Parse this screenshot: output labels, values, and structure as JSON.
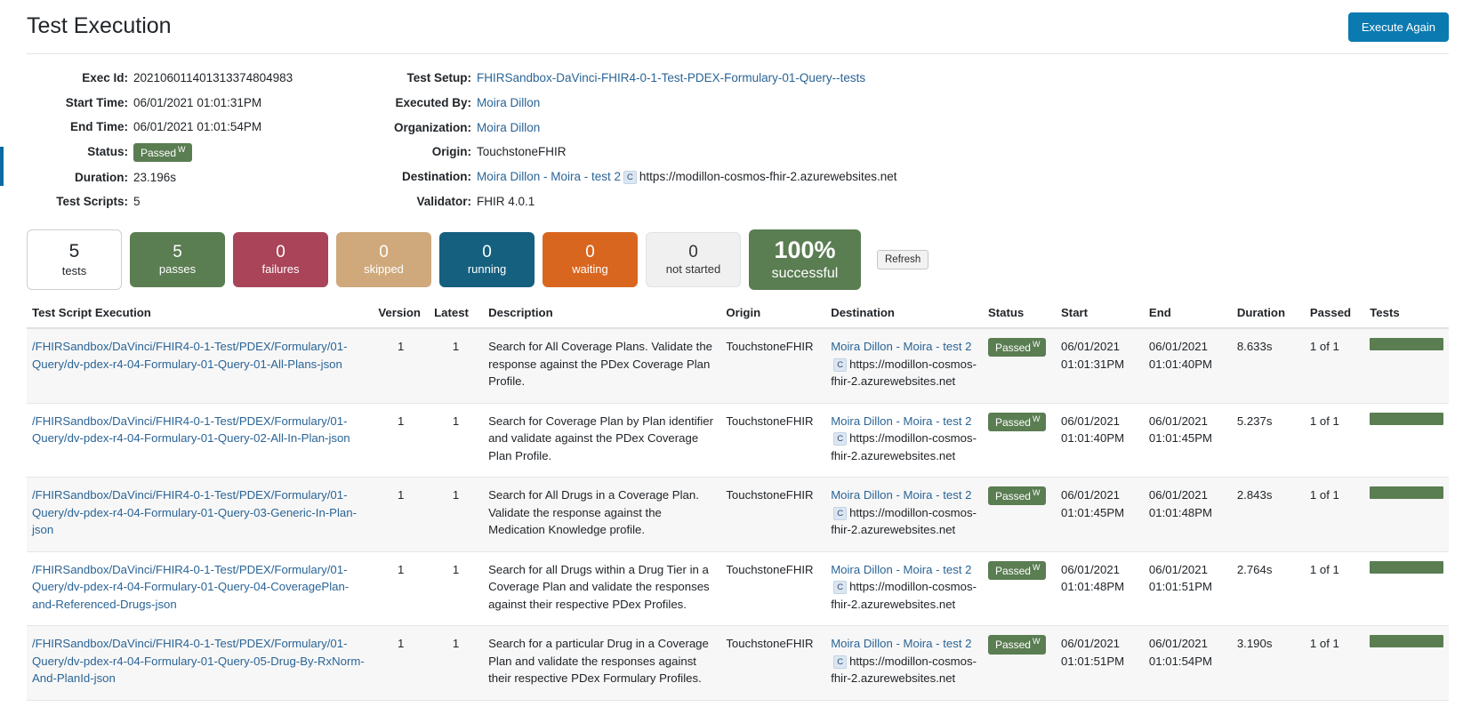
{
  "header": {
    "title": "Test Execution",
    "execute_again_label": "Execute Again"
  },
  "details": {
    "left": [
      {
        "label": "Exec Id:",
        "value": "202106011401313374804983",
        "type": "text"
      },
      {
        "label": "Start Time:",
        "value": "06/01/2021 01:01:31PM",
        "type": "text"
      },
      {
        "label": "End Time:",
        "value": "06/01/2021 01:01:54PM",
        "type": "text"
      },
      {
        "label": "Status:",
        "value": "Passed",
        "sup": "W",
        "type": "badge"
      },
      {
        "label": "Duration:",
        "value": "23.196s",
        "type": "text"
      },
      {
        "label": "Test Scripts:",
        "value": "5",
        "type": "text"
      }
    ],
    "right": [
      {
        "label": "Test Setup:",
        "value": "FHIRSandbox-DaVinci-FHIR4-0-1-Test-PDEX-Formulary-01-Query--tests",
        "type": "link"
      },
      {
        "label": "Executed By:",
        "value": "Moira Dillon",
        "type": "link"
      },
      {
        "label": "Organization:",
        "value": "Moira Dillon",
        "type": "link"
      },
      {
        "label": "Origin:",
        "value": "TouchstoneFHIR",
        "type": "text"
      },
      {
        "label": "Destination:",
        "value": "Moira Dillon - Moira - test 2",
        "cap": "C",
        "url": "https://modillon-cosmos-fhir-2.azurewebsites.net",
        "type": "dest"
      },
      {
        "label": "Validator:",
        "value": "FHIR 4.0.1",
        "type": "text"
      }
    ]
  },
  "stats": {
    "tiles": [
      {
        "num": "5",
        "label": "tests",
        "style": "tests",
        "color": "#ffffff"
      },
      {
        "num": "5",
        "label": "passes",
        "style": "passes",
        "color": "#5a7d52"
      },
      {
        "num": "0",
        "label": "failures",
        "style": "failures",
        "color": "#a94459"
      },
      {
        "num": "0",
        "label": "skipped",
        "style": "skipped",
        "color": "#cfa97b"
      },
      {
        "num": "0",
        "label": "running",
        "style": "running",
        "color": "#15607f"
      },
      {
        "num": "0",
        "label": "waiting",
        "style": "waiting",
        "color": "#d9661f"
      },
      {
        "num": "0",
        "label": "not started",
        "style": "notstarted",
        "color": "#f0f0f0"
      }
    ],
    "success": {
      "num": "100%",
      "label": "successful",
      "color": "#5a7d52"
    },
    "refresh_label": "Refresh"
  },
  "table": {
    "columns": [
      "Test Script Execution",
      "Version",
      "Latest",
      "Description",
      "Origin",
      "Destination",
      "Status",
      "Start",
      "End",
      "Duration",
      "Passed",
      "Tests"
    ],
    "rows": [
      {
        "script": "/FHIRSandbox/DaVinci/FHIR4-0-1-Test/PDEX/Formulary/01-Query/dv-pdex-r4-04-Formulary-01-Query-01-All-Plans-json",
        "version": "1",
        "latest": "1",
        "description": "Search for All Coverage Plans. Validate the response against the PDex Coverage Plan Profile.",
        "origin": "TouchstoneFHIR",
        "destination_name": "Moira Dillon - Moira - test 2",
        "destination_cap": "C",
        "destination_url": "https://modillon-cosmos-fhir-2.azurewebsites.net",
        "status": "Passed",
        "status_sup": "W",
        "start": "06/01/2021 01:01:31PM",
        "end": "06/01/2021 01:01:40PM",
        "duration": "8.633s",
        "passed": "1 of 1",
        "tests_pct": 100
      },
      {
        "script": "/FHIRSandbox/DaVinci/FHIR4-0-1-Test/PDEX/Formulary/01-Query/dv-pdex-r4-04-Formulary-01-Query-02-All-In-Plan-json",
        "version": "1",
        "latest": "1",
        "description": "Search for Coverage Plan by Plan identifier and validate against the PDex Coverage Plan Profile.",
        "origin": "TouchstoneFHIR",
        "destination_name": "Moira Dillon - Moira - test 2",
        "destination_cap": "C",
        "destination_url": "https://modillon-cosmos-fhir-2.azurewebsites.net",
        "status": "Passed",
        "status_sup": "W",
        "start": "06/01/2021 01:01:40PM",
        "end": "06/01/2021 01:01:45PM",
        "duration": "5.237s",
        "passed": "1 of 1",
        "tests_pct": 100
      },
      {
        "script": "/FHIRSandbox/DaVinci/FHIR4-0-1-Test/PDEX/Formulary/01-Query/dv-pdex-r4-04-Formulary-01-Query-03-Generic-In-Plan-json",
        "version": "1",
        "latest": "1",
        "description": "Search for All Drugs in a Coverage Plan. Validate the response against the Medication Knowledge profile.",
        "origin": "TouchstoneFHIR",
        "destination_name": "Moira Dillon - Moira - test 2",
        "destination_cap": "C",
        "destination_url": "https://modillon-cosmos-fhir-2.azurewebsites.net",
        "status": "Passed",
        "status_sup": "W",
        "start": "06/01/2021 01:01:45PM",
        "end": "06/01/2021 01:01:48PM",
        "duration": "2.843s",
        "passed": "1 of 1",
        "tests_pct": 100
      },
      {
        "script": "/FHIRSandbox/DaVinci/FHIR4-0-1-Test/PDEX/Formulary/01-Query/dv-pdex-r4-04-Formulary-01-Query-04-CoveragePlan-and-Referenced-Drugs-json",
        "version": "1",
        "latest": "1",
        "description": "Search for all Drugs within a Drug Tier in a Coverage Plan and validate the responses against their respective PDex Profiles.",
        "origin": "TouchstoneFHIR",
        "destination_name": "Moira Dillon - Moira - test 2",
        "destination_cap": "C",
        "destination_url": "https://modillon-cosmos-fhir-2.azurewebsites.net",
        "status": "Passed",
        "status_sup": "W",
        "start": "06/01/2021 01:01:48PM",
        "end": "06/01/2021 01:01:51PM",
        "duration": "2.764s",
        "passed": "1 of 1",
        "tests_pct": 100
      },
      {
        "script": "/FHIRSandbox/DaVinci/FHIR4-0-1-Test/PDEX/Formulary/01-Query/dv-pdex-r4-04-Formulary-01-Query-05-Drug-By-RxNorm-And-PlanId-json",
        "version": "1",
        "latest": "1",
        "description": "Search for a particular Drug in a Coverage Plan and validate the responses against their respective PDex Formulary Profiles.",
        "origin": "TouchstoneFHIR",
        "destination_name": "Moira Dillon - Moira - test 2",
        "destination_cap": "C",
        "destination_url": "https://modillon-cosmos-fhir-2.azurewebsites.net",
        "status": "Passed",
        "status_sup": "W",
        "start": "06/01/2021 01:01:51PM",
        "end": "06/01/2021 01:01:54PM",
        "duration": "3.190s",
        "passed": "1 of 1",
        "tests_pct": 100
      }
    ]
  }
}
